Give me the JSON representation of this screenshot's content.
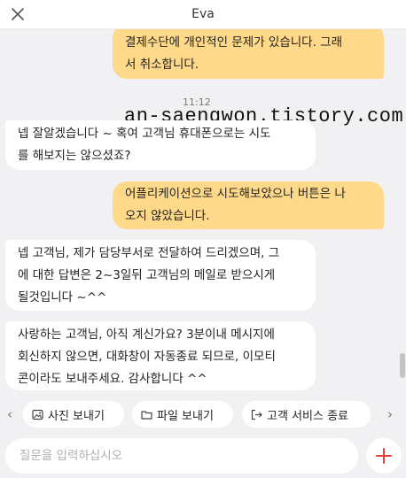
{
  "header": {
    "title": "Eva"
  },
  "messages": {
    "m1": {
      "line1": "결제수단에 개인적인 문제가 있습니다. 그래",
      "line2": "서 취소합니다."
    },
    "time": "11:12",
    "m2": {
      "line1": "넵 잘알겠습니다 ~ 혹여 고객님 휴대폰으로는 시도",
      "line2": "를 해보지는 않으셨죠?"
    },
    "m3": {
      "line1": "어플리케이션으로 시도해보았으나 버튼은 나",
      "line2": "오지 않았습니다."
    },
    "m4": {
      "line1": "넵 고객님, 제가 담당부서로 전달하여 드리겠으며, 그",
      "line2": "에 대한 답변은 2~3일뒤 고객님의 메일로 받으시게",
      "line3": "될것입니다 ~^^"
    },
    "m5": {
      "line1": "사랑하는 고객님, 아직 계신가요? 3분이내 메시지에",
      "line2": "회신하지 않으면, 대화창이 자동종료 되므로, 이모티",
      "line3": "콘이라도 보내주세요. 감사합니다 ^^"
    }
  },
  "watermark": "an-saengwon.tistory.com",
  "quick_actions": {
    "prev": "‹",
    "next": "›",
    "photo": "사진 보내기",
    "file": "파일 보내기",
    "agent": "고객 서비스 종료"
  },
  "input": {
    "placeholder": "질문을 입력하십시오"
  },
  "colors": {
    "accent": "#e8413c",
    "user_bubble": "#ffd98a",
    "bot_bubble": "#ffffff",
    "background": "#f1f1f3"
  },
  "icons": {
    "close": "close-icon",
    "photo": "image-icon",
    "file": "folder-icon",
    "agent": "exit-icon",
    "plus": "plus-icon"
  }
}
